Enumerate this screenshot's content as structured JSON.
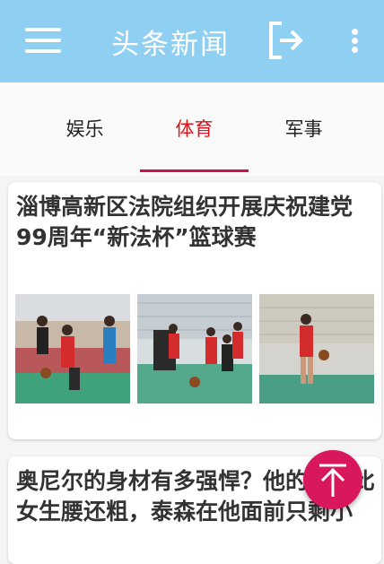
{
  "app_bar": {
    "title": "头条新闻",
    "menu_icon": "hamburger-menu-icon",
    "logout_icon": "logout-icon",
    "more_icon": "more-vertical-icon",
    "background_color": "#8fd0f2"
  },
  "tabs": [
    {
      "label": "娱乐",
      "active": false
    },
    {
      "label": "体育",
      "active": true
    },
    {
      "label": "军事",
      "active": false
    }
  ],
  "accent_color": "#d8131c",
  "indicator_color": "#c8144e",
  "news": [
    {
      "title": "淄博高新区法院组织开展庆祝建党99周年“新法杯”篮球赛",
      "images": [
        "basketball-photo-1",
        "basketball-photo-2",
        "basketball-photo-3"
      ]
    },
    {
      "title": "奥尼尔的身材有多强悍？他的手臂比女生腰还粗，泰森在他面前只剩小"
    }
  ],
  "fab": {
    "icon": "scroll-to-top-icon",
    "color": "#d8175c"
  }
}
